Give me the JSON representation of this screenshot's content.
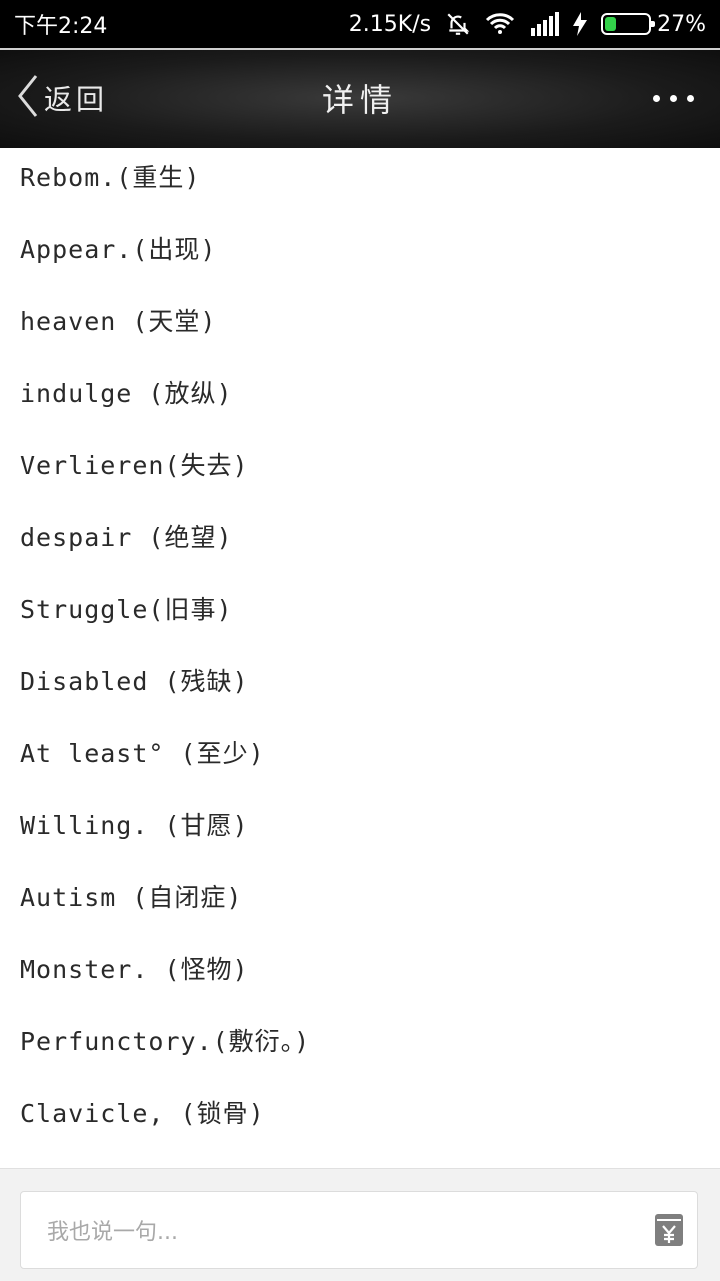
{
  "status_bar": {
    "time": "下午2:24",
    "network_speed": "2.15K/s",
    "battery_percent": "27%",
    "battery_level": 0.27
  },
  "nav": {
    "back_label": "返回",
    "title": "详情"
  },
  "lines": [
    "Rebom.(重生)",
    "Appear.(出现)",
    "heaven (天堂)",
    "indulge (放纵)",
    "Verlieren(失去)",
    "despair (绝望)",
    "Struggle(旧事)",
    "Disabled (残缺)",
    "At least° (至少)",
    "Willing. (甘愿)",
    "Autism (自闭症)",
    "Monster. (怪物)",
    "Perfunctory.(敷衍。)",
    "Clavicle, (锁骨)"
  ],
  "comment": {
    "placeholder": "我也说一句..."
  }
}
